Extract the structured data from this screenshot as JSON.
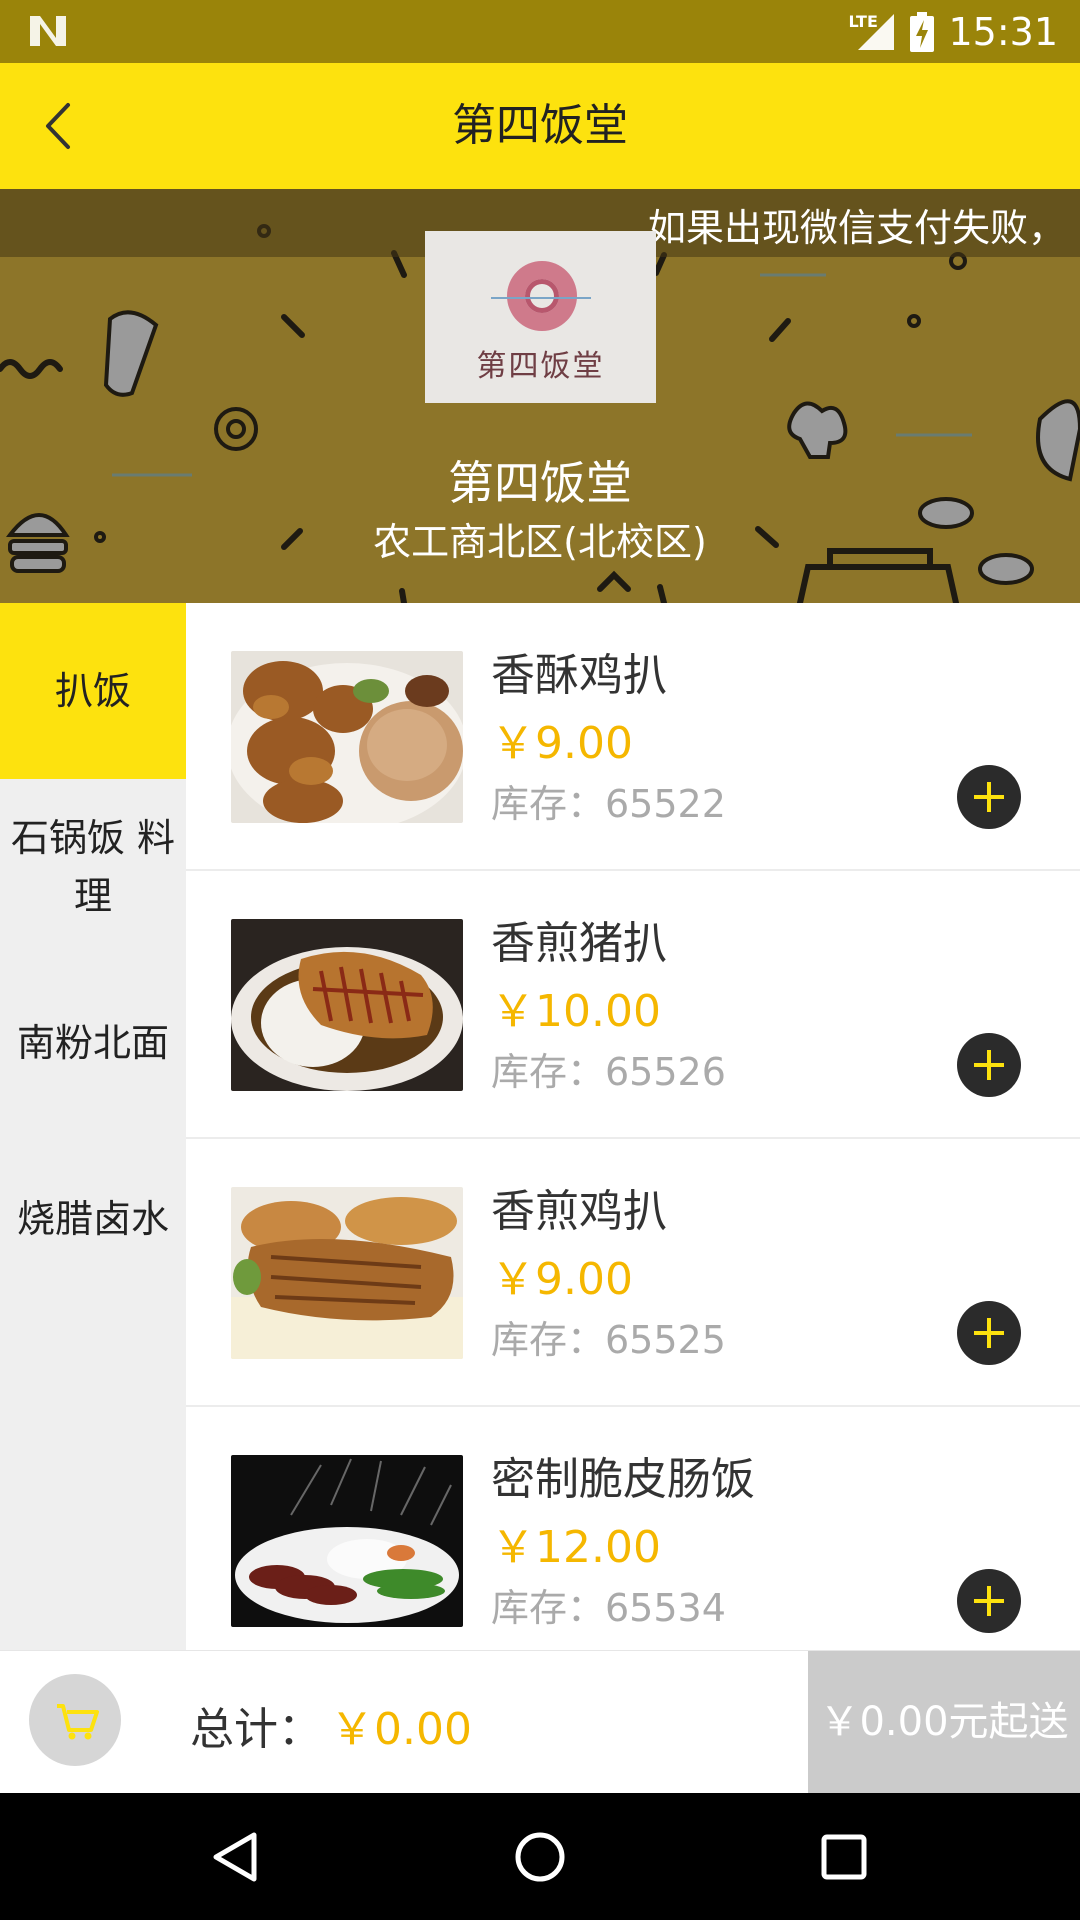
{
  "status_bar": {
    "network": "LTE",
    "time": "15:31"
  },
  "app_bar": {
    "title": "第四饭堂",
    "back_icon": "back-arrow-icon"
  },
  "banner": {
    "notice": "如果出现微信支付失败，",
    "logo_text": "第四饭堂",
    "shop_name": "第四饭堂",
    "shop_address": "农工商北区(北校区)",
    "background_color": "#8d7529"
  },
  "categories": [
    {
      "label": "扒饭",
      "active": true
    },
    {
      "label": "石锅饭 料理",
      "active": false
    },
    {
      "label": "南粉北面",
      "active": false
    },
    {
      "label": "烧腊卤水",
      "active": false
    }
  ],
  "products": [
    {
      "name": "香酥鸡扒",
      "price": "￥9.00",
      "stock": "库存：65522"
    },
    {
      "name": "香煎猪扒",
      "price": "￥10.00",
      "stock": "库存：65526"
    },
    {
      "name": "香煎鸡扒",
      "price": "￥9.00",
      "stock": "库存：65525"
    },
    {
      "name": "密制脆皮肠饭",
      "price": "￥12.00",
      "stock": "库存：65534"
    }
  ],
  "cart": {
    "total_label": "总计：",
    "total_value": "￥0.00",
    "min_order_label": "￥0.00元起送",
    "cart_icon": "shopping-cart-icon"
  },
  "colors": {
    "accent_yellow": "#fde20e",
    "price_orange": "#f5b700",
    "status_bar": "#9a840a"
  }
}
